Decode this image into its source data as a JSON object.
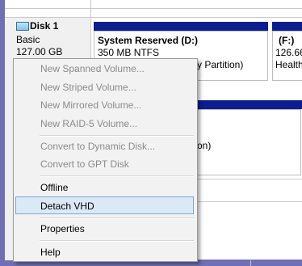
{
  "disk": {
    "name": "Disk 1",
    "type": "Basic",
    "size": "127.00 GB"
  },
  "volumes": [
    {
      "name": "System Reserved  (D:)",
      "detail": "350 MB NTFS",
      "status_fragment": "y Partition)"
    },
    {
      "name": "(F:)",
      "detail": "126.66",
      "status_fragment": "Health"
    }
  ],
  "lower_volume": {
    "status_fragment": "on)"
  },
  "context_menu": {
    "items": [
      {
        "label": "New Spanned Volume...",
        "enabled": false
      },
      {
        "label": "New Striped Volume...",
        "enabled": false
      },
      {
        "label": "New Mirrored Volume...",
        "enabled": false
      },
      {
        "label": "New RAID-5 Volume...",
        "enabled": false
      },
      {
        "label": "Convert to Dynamic Disk...",
        "enabled": false
      },
      {
        "label": "Convert to GPT Disk",
        "enabled": false
      },
      {
        "label": "Offline",
        "enabled": true
      },
      {
        "label": "Detach VHD",
        "enabled": true,
        "highlighted": true
      },
      {
        "label": "Properties",
        "enabled": true
      },
      {
        "label": "Help",
        "enabled": true
      }
    ]
  },
  "colors": {
    "volume_bar": "#0c1e8f",
    "frame": "#6f6fb5",
    "menu_highlight": "#dbe9f7"
  }
}
